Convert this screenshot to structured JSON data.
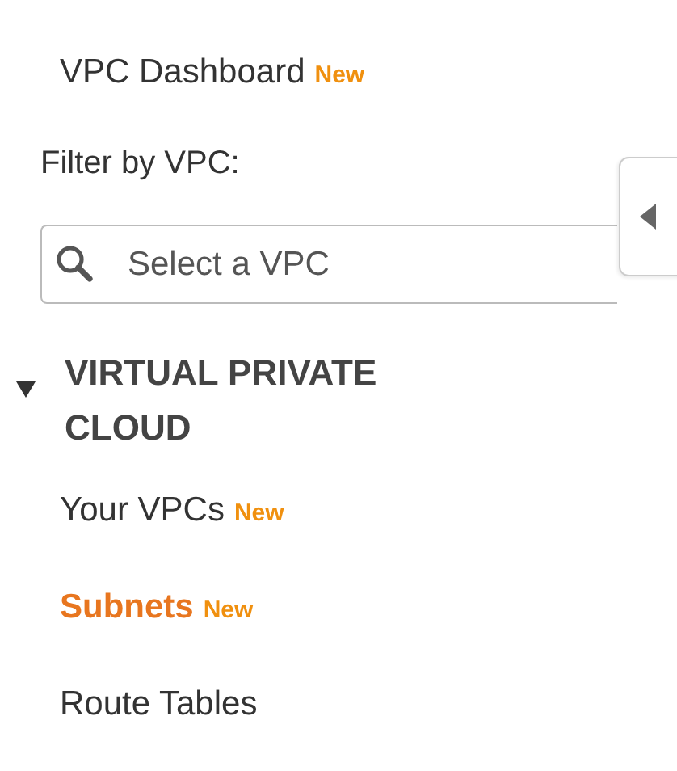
{
  "dashboard": {
    "label": "VPC Dashboard",
    "badge": "New"
  },
  "filter": {
    "label": "Filter by VPC:",
    "placeholder": "Select a VPC"
  },
  "section": {
    "title": "VIRTUAL PRIVATE CLOUD",
    "expanded": true,
    "items": [
      {
        "label": "Your VPCs",
        "badge": "New",
        "selected": false
      },
      {
        "label": "Subnets",
        "badge": "New",
        "selected": true
      },
      {
        "label": "Route Tables",
        "selected": false
      }
    ]
  }
}
